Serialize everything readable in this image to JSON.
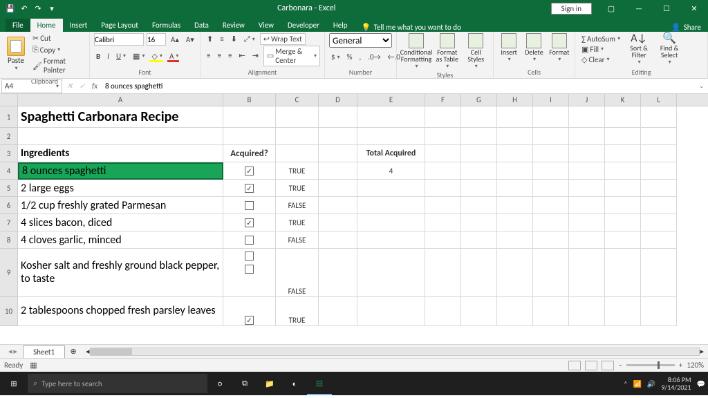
{
  "title_bar": {
    "app_title": "Carbonara  -  Excel",
    "signin": "Sign in"
  },
  "tabs": {
    "file": "File",
    "home": "Home",
    "insert": "Insert",
    "page_layout": "Page Layout",
    "formulas": "Formulas",
    "data": "Data",
    "review": "Review",
    "view": "View",
    "developer": "Developer",
    "help": "Help",
    "tellme": "Tell me what you want to do",
    "share": "Share"
  },
  "ribbon": {
    "clipboard": {
      "paste": "Paste",
      "cut": "Cut",
      "copy": "Copy",
      "fmt": "Format Painter",
      "label": "Clipboard"
    },
    "font": {
      "name": "Calibri",
      "size": "16",
      "label": "Font"
    },
    "alignment": {
      "wrap": "Wrap Text",
      "merge": "Merge & Center",
      "label": "Alignment"
    },
    "number": {
      "fmt": "General",
      "label": "Number"
    },
    "styles": {
      "cf": "Conditional Formatting",
      "fat": "Format as Table",
      "cs": "Cell Styles",
      "label": "Styles"
    },
    "cells": {
      "ins": "Insert",
      "del": "Delete",
      "fmt": "Format",
      "label": "Cells"
    },
    "editing": {
      "sum": "AutoSum",
      "fill": "Fill",
      "clear": "Clear",
      "sort": "Sort & Filter",
      "find": "Find & Select",
      "label": "Editing"
    }
  },
  "fx": {
    "namebox": "A4",
    "formula": "8 ounces spaghetti"
  },
  "cols": [
    "A",
    "B",
    "C",
    "D",
    "E",
    "F",
    "G",
    "H",
    "I",
    "J",
    "K",
    "L"
  ],
  "rows": [
    "1",
    "2",
    "3",
    "4",
    "5",
    "6",
    "7",
    "8",
    "9",
    "10"
  ],
  "cells": {
    "A1": "Spaghetti Carbonara Recipe",
    "A3": "Ingredients",
    "B3": "Acquired?",
    "E3": "Total Acquired",
    "A4": "8 ounces spaghetti",
    "C4": "TRUE",
    "E4": "4",
    "A5": "2 large eggs",
    "C5": "TRUE",
    "A6": "1/2 cup freshly grated Parmesan",
    "C6": "FALSE",
    "A7": "4 slices bacon, diced",
    "C7": "TRUE",
    "A8": "4 cloves garlic, minced",
    "C8": "FALSE",
    "A9": "Kosher salt and freshly ground black pepper, to taste",
    "C9": "FALSE",
    "A10": "2 tablespoons chopped fresh parsley leaves",
    "C10": "TRUE"
  },
  "checks": {
    "b4": "✓",
    "b5": "✓",
    "b6": "",
    "b7": "✓",
    "b8": "",
    "b9a": "",
    "b9b": "",
    "b10": "✓"
  },
  "sheet": {
    "name": "Sheet1"
  },
  "status": {
    "ready": "Ready",
    "zoom": "120%"
  },
  "taskbar": {
    "search": "Type here to search",
    "time": "8:06 PM",
    "date": "9/14/2021"
  }
}
